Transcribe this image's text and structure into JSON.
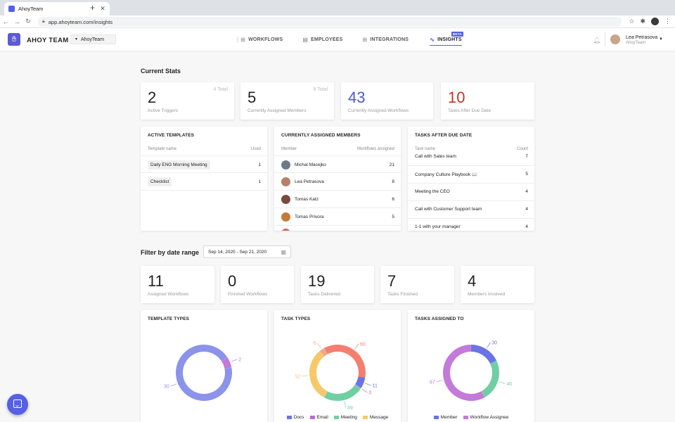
{
  "browser": {
    "tab_title": "AhoyTeam",
    "url": "app.ahoyteam.com/insights"
  },
  "header": {
    "brand": "AHOY TEAM",
    "team_select": "AhoyTeam",
    "nav": [
      {
        "label": "WORKFLOWS",
        "icon": "workflow-icon"
      },
      {
        "label": "EMPLOYEES",
        "icon": "employees-icon"
      },
      {
        "label": "INTEGRATIONS",
        "icon": "integrations-icon"
      },
      {
        "label": "INSIGHTS",
        "icon": "chart-line-icon",
        "badge": "BETA",
        "active": true
      }
    ],
    "user_name": "Lea Petrasova",
    "user_team": "AhoyTeam"
  },
  "current_stats": {
    "title": "Current Stats",
    "cards": [
      {
        "value": "2",
        "label": "Active Triggers",
        "total": "4 Total",
        "color": "#222222"
      },
      {
        "value": "5",
        "label": "Currently Assigned Members",
        "total": "8 Total",
        "color": "#222222"
      },
      {
        "value": "43",
        "label": "Currently Assigned Workflows",
        "total": "",
        "color": "#4a57d6"
      },
      {
        "value": "10",
        "label": "Tasks After Due Date",
        "total": "",
        "color": "#c8322a"
      }
    ]
  },
  "active_templates": {
    "title": "ACTIVE TEMPLATES",
    "col_name": "Template name",
    "col_used": "Used",
    "rows": [
      {
        "name": "Daily ENG Morning Meeting",
        "used": "1"
      },
      {
        "name": "Checklist",
        "used": "1"
      }
    ]
  },
  "assigned_members": {
    "title": "CURRENTLY ASSIGNED MEMBERS",
    "col_member": "Member",
    "col_count": "Workflows assigned",
    "rows": [
      {
        "name": "Michal Macejko",
        "count": "21",
        "avatar_color": "#6d7a88"
      },
      {
        "name": "Lea Petrasova",
        "count": "8",
        "avatar_color": "#b5806a"
      },
      {
        "name": "Tomas Katz",
        "count": "6",
        "avatar_color": "#7a4a3a"
      },
      {
        "name": "Tomas Privora",
        "count": "5",
        "avatar_color": "#c47a3a"
      }
    ]
  },
  "tasks_after_due": {
    "title": "TASKS AFTER DUE DATE",
    "col_name": "Task name",
    "col_count": "Count",
    "rows": [
      {
        "name": "Call with Sales team",
        "count": "7"
      },
      {
        "name": "Company Culture Playbook 📖",
        "count": "5"
      },
      {
        "name": "Meeting the CEO",
        "count": "4"
      },
      {
        "name": "Call with Customer Support team",
        "count": "4"
      },
      {
        "name": "1-1 with your manager",
        "count": "4"
      }
    ]
  },
  "filter": {
    "title": "Filter by date range",
    "date_range": "Sep 14, 2020 - Sep 21, 2020"
  },
  "range_stats": [
    {
      "value": "11",
      "label": "Assigned Workflows"
    },
    {
      "value": "0",
      "label": "Finished Workflows"
    },
    {
      "value": "19",
      "label": "Tasks Delivered"
    },
    {
      "value": "7",
      "label": "Tasks Finished"
    },
    {
      "value": "4",
      "label": "Members Involved"
    }
  ],
  "chart_data": [
    {
      "type": "pie",
      "title": "TEMPLATE TYPES",
      "series": [
        {
          "value": 30,
          "color": "#8b93ea"
        },
        {
          "value": 2,
          "color": "#c37ad8"
        }
      ],
      "legend": []
    },
    {
      "type": "pie",
      "title": "TASK TYPES",
      "series": [
        {
          "name": "Docs",
          "value": 11,
          "color": "#6a74e4"
        },
        {
          "name": "Email",
          "value": 0,
          "color": "#b86bd6"
        },
        {
          "name": "Meeting",
          "value": 39,
          "color": "#6fcfa3"
        },
        {
          "name": "Message",
          "value": 52,
          "color": "#f7c86a"
        },
        {
          "value": 5,
          "color": "#f3a98b"
        },
        {
          "value": 60,
          "color": "#f47f6e"
        }
      ],
      "legend": [
        "Docs",
        "Email",
        "Meeting",
        "Message"
      ]
    },
    {
      "type": "pie",
      "title": "TASKS ASSIGNED TO",
      "series": [
        {
          "name": "Member",
          "value": 30,
          "color": "#6a74e4"
        },
        {
          "value": 40,
          "color": "#6fcfa3"
        },
        {
          "name": "Workflow Assignee",
          "value": 97,
          "color": "#c37ad8"
        }
      ],
      "legend": [
        "Member",
        "Workflow Assignee"
      ]
    }
  ]
}
